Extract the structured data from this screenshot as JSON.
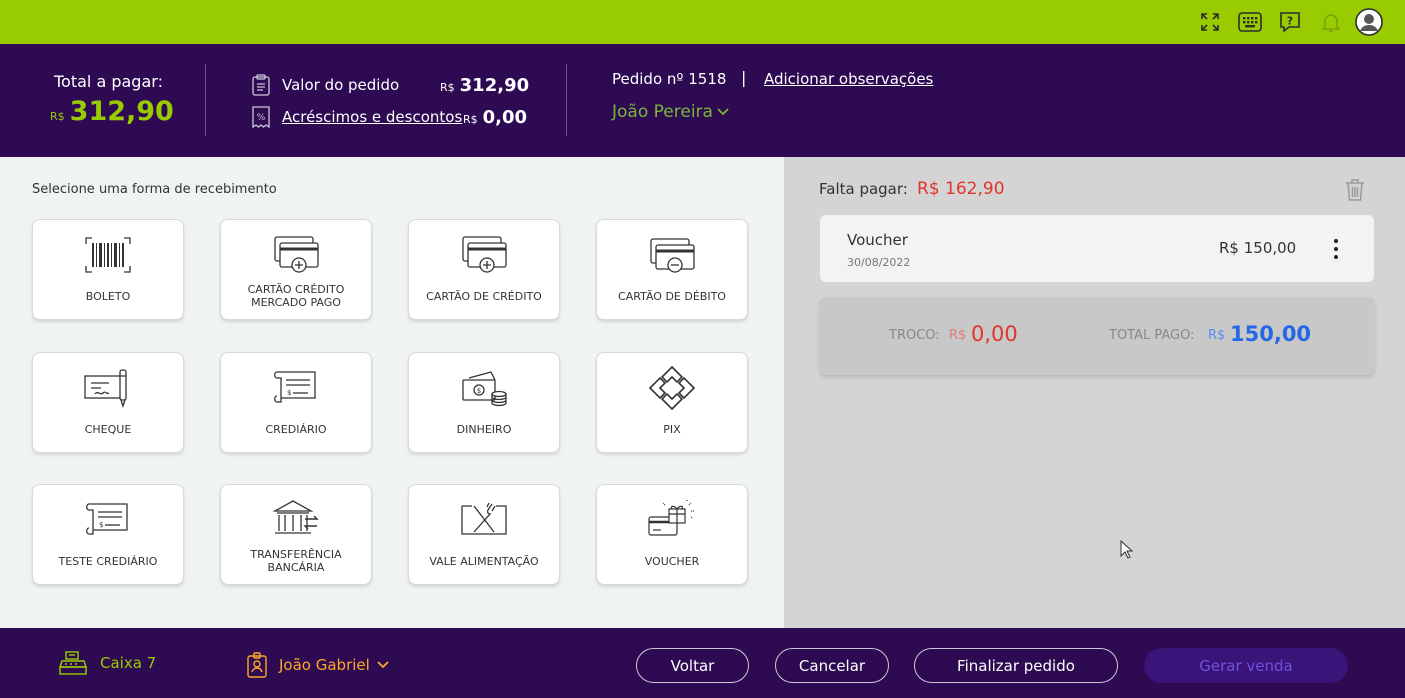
{
  "topbar": {
    "icons": [
      "fullscreen-icon",
      "keypad-icon",
      "help-icon",
      "bell-icon",
      "user-avatar-icon"
    ],
    "accent_color": "#99cc00"
  },
  "header": {
    "total_label": "Total a pagar:",
    "total_currency": "R$",
    "total_value": "312,90",
    "valor_pedido_label": "Valor do pedido",
    "valor_pedido_currency": "R$",
    "valor_pedido_value": "312,90",
    "acrescimos_label": "Acréscimos e descontos",
    "acrescimos_currency": "R$",
    "acrescimos_value": "0,00",
    "pedido_label": "Pedido nº 1518",
    "separator": "|",
    "observacoes_link": "Adicionar observações",
    "cliente_name": "João Pereira",
    "background_color": "#2d0a52"
  },
  "payment_methods": {
    "title": "Selecione uma forma de recebimento",
    "items": [
      {
        "label": "BOLETO",
        "icon": "barcode-icon"
      },
      {
        "label": "CARTÃO CRÉDITO MERCADO PAGO",
        "icon": "credit-card-plus-icon"
      },
      {
        "label": "CARTÃO DE CRÉDITO",
        "icon": "credit-card-plus-icon"
      },
      {
        "label": "CARTÃO DE DÉBITO",
        "icon": "debit-card-minus-icon"
      },
      {
        "label": "CHEQUE",
        "icon": "cheque-pen-icon"
      },
      {
        "label": "CREDIÁRIO",
        "icon": "crediario-scroll-icon"
      },
      {
        "label": "DINHEIRO",
        "icon": "cash-coins-icon"
      },
      {
        "label": "PIX",
        "icon": "pix-icon"
      },
      {
        "label": "TESTE CREDIÁRIO",
        "icon": "crediario-scroll-icon"
      },
      {
        "label": "TRANSFERÊNCIA BANCÁRIA",
        "icon": "bank-transfer-icon"
      },
      {
        "label": "VALE ALIMENTAÇÃO",
        "icon": "fork-knife-icon"
      },
      {
        "label": "VOUCHER",
        "icon": "voucher-gift-icon"
      }
    ]
  },
  "summary_panel": {
    "falta_label": "Falta pagar:",
    "falta_value": "R$ 162,90",
    "payments": [
      {
        "name": "Voucher",
        "date": "30/08/2022",
        "value": "R$ 150,00"
      }
    ],
    "troco_label": "TROCO:",
    "troco_currency": "R$",
    "troco_value": "0,00",
    "total_pago_label": "TOTAL PAGO:",
    "total_pago_currency": "R$",
    "total_pago_value": "150,00",
    "falta_color": "#e0352b",
    "total_pago_color": "#2468e8"
  },
  "footer": {
    "caixa_label": "Caixa 7",
    "operador_name": "João Gabriel",
    "buttons": {
      "voltar": "Voltar",
      "cancelar": "Cancelar",
      "finalizar": "Finalizar pedido",
      "gerar": "Gerar venda"
    }
  }
}
